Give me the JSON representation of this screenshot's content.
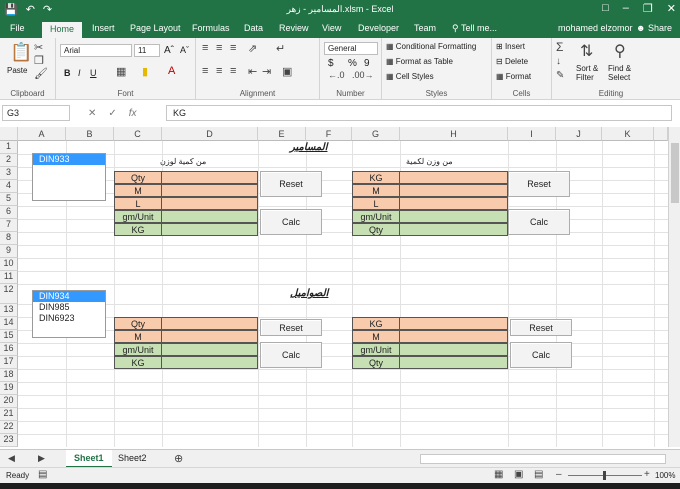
{
  "title_bar": {
    "title": "المسامير - زهر.xlsm - Excel",
    "save_icon": "save-icon",
    "undo_icon": "undo-icon",
    "redo_icon": "redo-icon"
  },
  "tabs": [
    {
      "label": "File"
    },
    {
      "label": "Home"
    },
    {
      "label": "Insert"
    },
    {
      "label": "Page Layout"
    },
    {
      "label": "Formulas"
    },
    {
      "label": "Data"
    },
    {
      "label": "Review"
    },
    {
      "label": "View"
    },
    {
      "label": "Developer"
    },
    {
      "label": "Team"
    },
    {
      "label": "Tell me..."
    }
  ],
  "user": {
    "name": "mohamed elzomor",
    "share": "Share"
  },
  "ribbon": {
    "clipboard": {
      "label": "Clipboard",
      "paste": "Paste"
    },
    "font": {
      "label": "Font",
      "name": "Arial",
      "size": "11",
      "bold": "B",
      "italic": "I",
      "underline": "U"
    },
    "alignment": {
      "label": "Alignment"
    },
    "number": {
      "label": "Number",
      "format": "General",
      "currency": "$",
      "percent": "%",
      "comma": "9"
    },
    "styles": {
      "label": "Styles",
      "conditional": "Conditional Formatting",
      "table": "Format as Table",
      "cell": "Cell Styles"
    },
    "cells": {
      "label": "Cells",
      "insert": "Insert",
      "delete": "Delete",
      "format": "Format"
    },
    "editing": {
      "label": "Editing",
      "sort": "Sort & Filter",
      "find": "Find & Select"
    }
  },
  "formula_bar": {
    "name_box": "G3",
    "fx": "fx",
    "formula": "KG"
  },
  "columns": [
    "A",
    "B",
    "C",
    "D",
    "E",
    "F",
    "G",
    "H",
    "I",
    "J",
    "K"
  ],
  "rows": [
    "1",
    "2",
    "3",
    "4",
    "5",
    "6",
    "7",
    "8",
    "9",
    "10",
    "11",
    "12",
    "13",
    "14",
    "15",
    "16",
    "17",
    "18",
    "19",
    "20",
    "21",
    "22",
    "23"
  ],
  "sheet": {
    "heading1": "المسامير",
    "heading2": "الصواميل",
    "sub_left": "من كمية لوزن",
    "sub_right": "من وزن لكمية",
    "list1": [
      "DIN933"
    ],
    "list2": [
      "DIN934",
      "DIN985",
      "DIN6923"
    ],
    "block1_left": [
      "Qty",
      "M",
      "L",
      "gm/Unit",
      "KG"
    ],
    "block1_right": [
      "KG",
      "M",
      "L",
      "gm/Unit",
      "Qty"
    ],
    "block2_left": [
      "Qty",
      "M",
      "gm/Unit",
      "KG"
    ],
    "block2_right": [
      "KG",
      "M",
      "gm/Unit",
      "Qty"
    ],
    "reset_label": "Reset",
    "calc_label": "Calc"
  },
  "sheet_tabs": {
    "sheet1": "Sheet1",
    "sheet2": "Sheet2"
  },
  "status": {
    "ready": "Ready",
    "zoom": "100%"
  }
}
